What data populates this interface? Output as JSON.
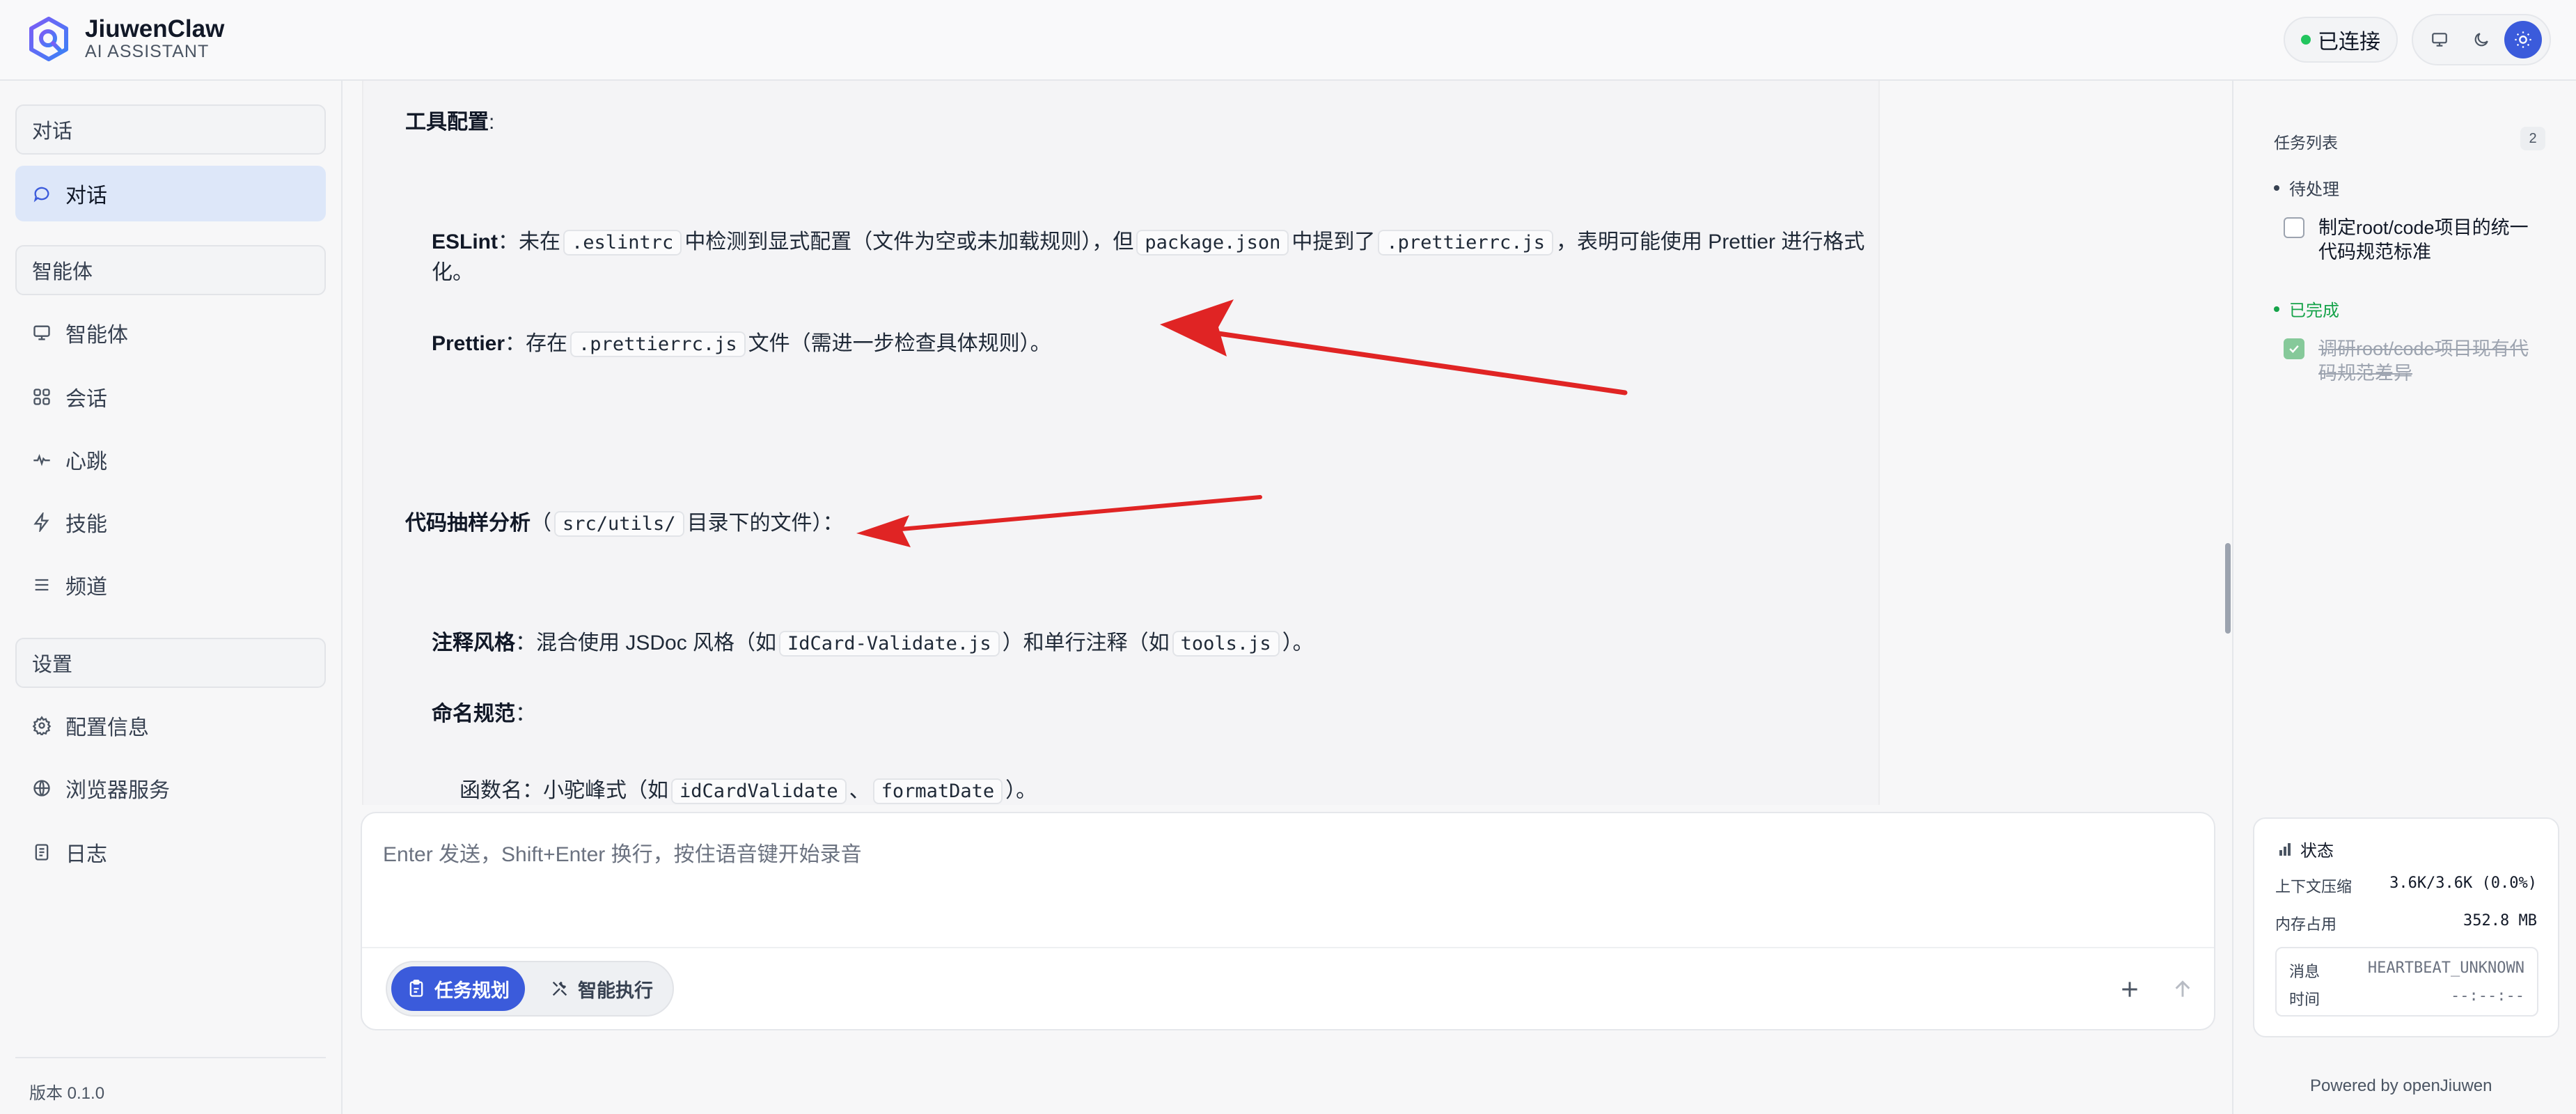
{
  "header": {
    "brand_name": "JiuwenClaw",
    "brand_sub": "AI ASSISTANT",
    "connection_status": "已连接",
    "colors": {
      "accent": "#3b5bdb",
      "connected": "#22c55e"
    }
  },
  "sidebar": {
    "sections": [
      {
        "label": "对话"
      },
      {
        "label": "智能体"
      },
      {
        "label": "设置"
      }
    ],
    "items": [
      {
        "label": "对话",
        "icon": "chat-icon",
        "active": true
      },
      {
        "label": "智能体",
        "icon": "monitor-icon"
      },
      {
        "label": "会话",
        "icon": "session-icon"
      },
      {
        "label": "心跳",
        "icon": "heartbeat-icon"
      },
      {
        "label": "技能",
        "icon": "bolt-icon"
      },
      {
        "label": "频道",
        "icon": "list-icon"
      },
      {
        "label": "配置信息",
        "icon": "gear-icon"
      },
      {
        "label": "浏览器服务",
        "icon": "globe-icon"
      },
      {
        "label": "日志",
        "icon": "log-icon"
      }
    ],
    "version": "版本 0.1.0"
  },
  "doc": {
    "tool_config_label": "工具配置",
    "colon": ":",
    "eslint": {
      "label": "ESLint",
      "t1": "：未在",
      "c1": ".eslintrc",
      "t2": "中检测到显式配置（文件为空或未加载规则），但",
      "c2": "package.json",
      "t3": "中提到了",
      "c3": ".prettierrc.js",
      "t4": "，表明可能使用 Prettier 进行格式",
      "t5": "化。"
    },
    "prettier": {
      "label": "Prettier",
      "t1": "：存在",
      "c1": ".prettierrc.js",
      "t2": "文件（需进一步检查具体规则）。"
    },
    "sample": {
      "label": "代码抽样分析",
      "t1": "（",
      "c1": "src/utils/",
      "t2": "目录下的文件）："
    },
    "comment": {
      "label": "注释风格",
      "t1": "：混合使用 JSDoc 风格（如",
      "c1": "IdCard-Validate.js",
      "t2": "）和单行注释（如",
      "c2": "tools.js",
      "t3": "）。"
    },
    "naming": {
      "label": "命名规范",
      "t1": "："
    },
    "funcname": {
      "t1": "函数名：小驼峰式（如",
      "c1": "idCardValidate",
      "t2": "、",
      "c2": "formatDate",
      "t3": "）。"
    }
  },
  "composer": {
    "placeholder": "Enter 发送，Shift+Enter 换行，按住语音键开始录音",
    "modes": [
      {
        "label": "任务规划",
        "icon": "clipboard-icon",
        "active": true
      },
      {
        "label": "智能执行",
        "icon": "tools-icon"
      }
    ]
  },
  "tasks": {
    "title": "任务列表",
    "count": "2",
    "groups": [
      {
        "label": "待处理",
        "color": "#374151",
        "items": [
          {
            "text": "制定root/code项目的统一代码规范标准",
            "done": false
          }
        ]
      },
      {
        "label": "已完成",
        "color": "#16a34a",
        "items": [
          {
            "text": "调研root/code项目现有代码规范差异",
            "done": true
          }
        ]
      }
    ]
  },
  "status": {
    "title": "状态",
    "context_label": "上下文压缩",
    "context_value": "3.6K/3.6K (0.0%)",
    "memory_label": "内存占用",
    "memory_value": "352.8 MB",
    "message_label": "消息",
    "message_value": "HEARTBEAT_UNKNOWN",
    "time_label": "时间",
    "time_value": "--:--:--"
  },
  "footer": {
    "powered_by": "Powered by openJiuwen"
  }
}
